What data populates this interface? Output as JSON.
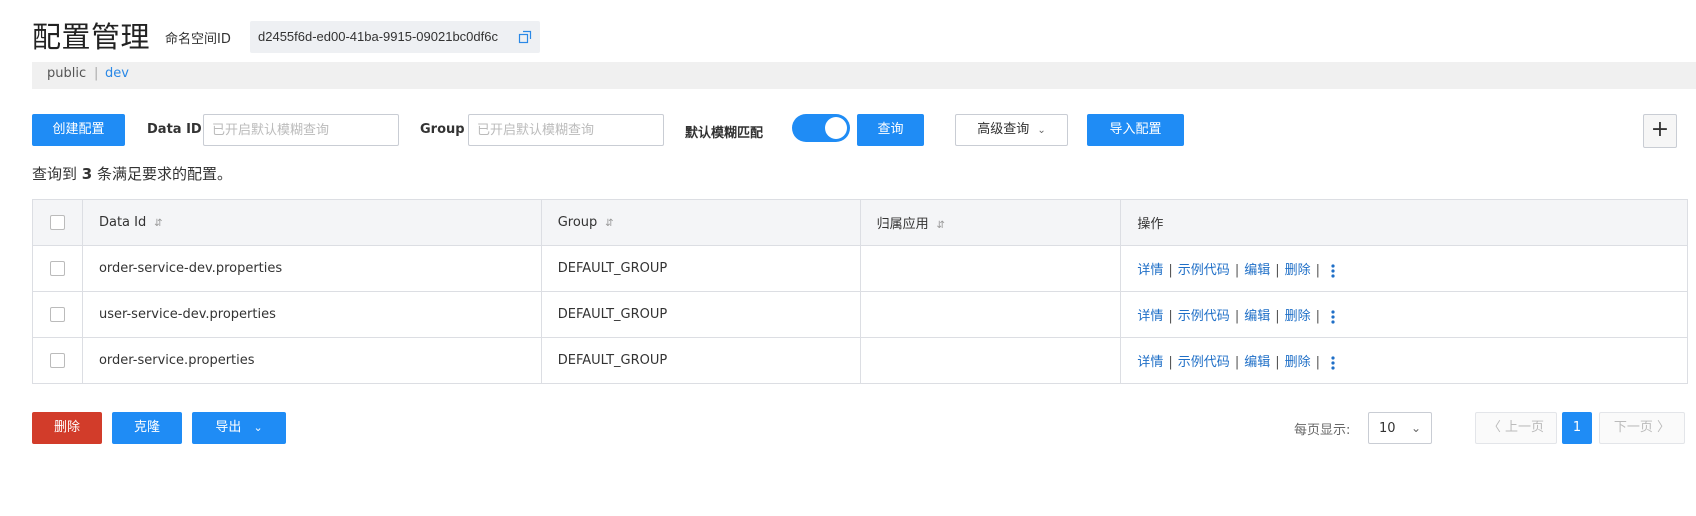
{
  "header": {
    "title": "配置管理",
    "namespace_label": "命名空间ID",
    "namespace_id": "d2455f6d-ed00-41ba-9915-09021bc0df6c"
  },
  "namespaces": {
    "public": "public",
    "separator": "|",
    "dev": "dev"
  },
  "toolbar": {
    "create_label": "创建配置",
    "dataid_label": "Data ID",
    "dataid_placeholder": "已开启默认模糊查询",
    "group_label": "Group",
    "group_placeholder": "已开启默认模糊查询",
    "fuzzy_label": "默认模糊匹配",
    "fuzzy_on": true,
    "query_label": "查询",
    "advanced_label": "高级查询",
    "advanced_arrow": "⌄",
    "import_label": "导入配置",
    "plus_label": "+"
  },
  "summary": {
    "prefix": "查询到",
    "count": "3",
    "suffix": "条满足要求的配置。"
  },
  "table": {
    "columns": [
      "Data Id",
      "Group",
      "归属应用",
      "操作"
    ],
    "sort_glyph": "⇵",
    "rows": [
      {
        "data_id": "order-service-dev.properties",
        "group": "DEFAULT_GROUP",
        "app": ""
      },
      {
        "data_id": "user-service-dev.properties",
        "group": "DEFAULT_GROUP",
        "app": ""
      },
      {
        "data_id": "order-service.properties",
        "group": "DEFAULT_GROUP",
        "app": ""
      }
    ],
    "actions": {
      "detail": "详情",
      "sample": "示例代码",
      "edit": "编辑",
      "delete": "删除",
      "sep": "|"
    }
  },
  "bottom": {
    "delete_label": "删除",
    "clone_label": "克隆",
    "export_label": "导出",
    "export_arrow": "⌄",
    "page_size_label": "每页显示:",
    "page_size_value": "10",
    "prev_label": "〈 上一页",
    "page_current": "1",
    "next_label": "下一页 〉"
  },
  "colors": {
    "primary": "#1f8cf5",
    "danger": "#d23c2a",
    "link": "#1f6fc7"
  }
}
